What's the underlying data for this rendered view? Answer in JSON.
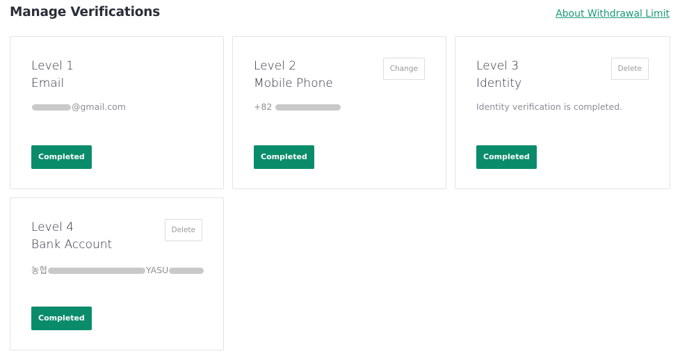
{
  "header": {
    "title": "Manage Verifications",
    "link_label": "About Withdrawal Limit"
  },
  "cards": [
    {
      "level": "Level 1",
      "kind": "Email",
      "detail_prefix": "",
      "detail_suffix": "@gmail.com",
      "status": "Completed"
    },
    {
      "level": "Level 2",
      "kind": "Mobile Phone",
      "detail_prefix": "+82",
      "detail_suffix": "",
      "status": "Completed",
      "action": "Change"
    },
    {
      "level": "Level 3",
      "kind": "Identity",
      "detail": "Identity verification is completed.",
      "status": "Completed",
      "action": "Delete"
    },
    {
      "level": "Level 4",
      "kind": "Bank Account",
      "detail_prefix": "농협",
      "detail_middle": "YASU",
      "status": "Completed",
      "action": "Delete"
    }
  ],
  "colors": {
    "accent": "#0a8c6b",
    "link": "#1b9a78",
    "border": "#e3e3e3"
  }
}
